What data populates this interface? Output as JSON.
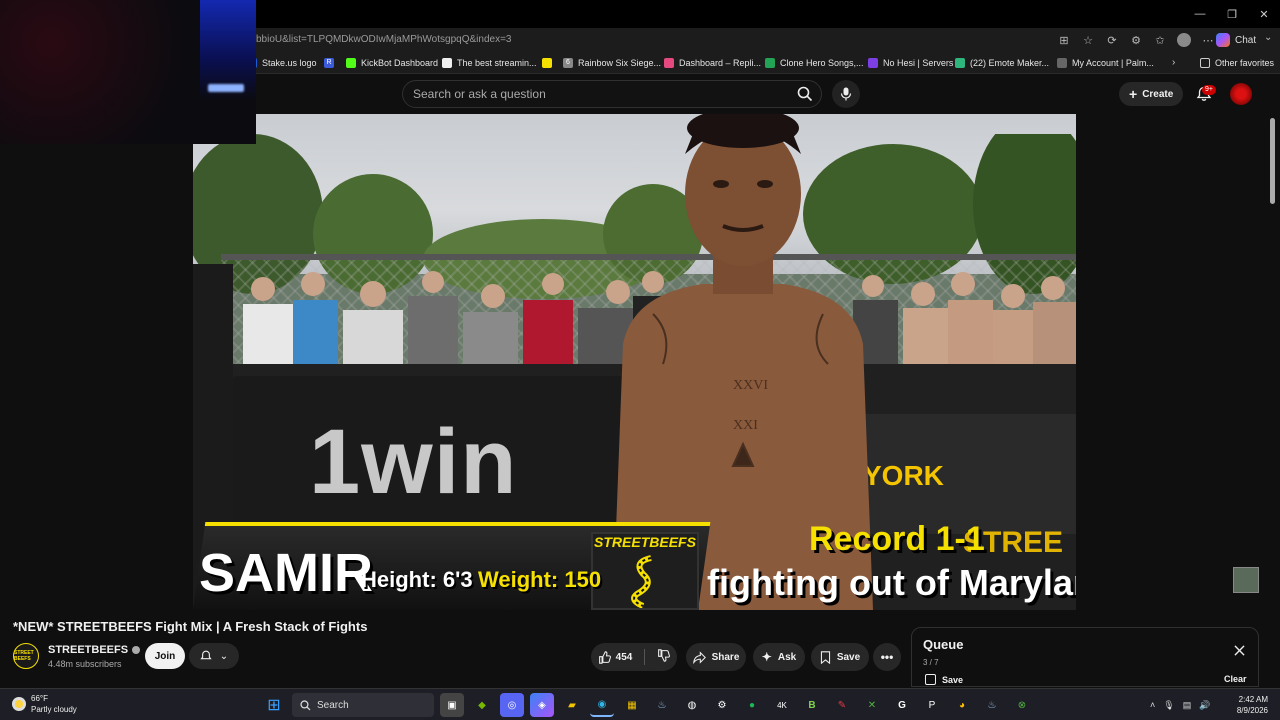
{
  "browser": {
    "url": "bbioU&list=TLPQMDkwODIwMjaMPhWotsgpqQ&index=3",
    "chat_label": "Chat",
    "bookmarks": [
      {
        "label": "Stake.us logo",
        "color": "#1e5bd8"
      },
      {
        "label": "",
        "color": "#3b5bdb",
        "glyph": "R"
      },
      {
        "label": "KickBot Dashboard",
        "color": "#53fc18"
      },
      {
        "label": "The best streamin...",
        "color": "#eeeeee"
      },
      {
        "label": "",
        "color": "#f5e000"
      },
      {
        "label": "Rainbow Six Siege...",
        "color": "#888888",
        "glyph": "6"
      },
      {
        "label": "Dashboard – Repli...",
        "color": "#e64980"
      },
      {
        "label": "Clone Hero Songs,...",
        "color": "#22a355"
      },
      {
        "label": "No Hesi | Servers",
        "color": "#7b3fe4"
      },
      {
        "label": "(22) Emote Maker...",
        "color": "#2fb67c"
      },
      {
        "label": "My Account | Palm...",
        "color": "#666666"
      }
    ],
    "other_favorites": "Other favorites"
  },
  "youtube": {
    "search_placeholder": "Search or ask a question",
    "create_label": "Create",
    "notification_count": "9+"
  },
  "video": {
    "brand": "1win",
    "board_text": "YORK",
    "board_text_2": "STREE",
    "logo_text": "STREETBEEFS",
    "fighter_name": "SAMIR",
    "height": "Height: 6'3",
    "weight": "Weight: 150",
    "record": "Record 1-1",
    "origin": "fighting out of Maryland"
  },
  "watch": {
    "title": "*NEW* STREETBEEFS Fight Mix | A Fresh Stack of Fights",
    "channel_name": "STREETBEEFS",
    "subscribers": "4.48m subscribers",
    "channel_avatar_text": "STREET BEEFS",
    "join_label": "Join",
    "like_count": "454",
    "share_label": "Share",
    "ask_label": "Ask",
    "save_label": "Save"
  },
  "queue": {
    "title": "Queue",
    "count": "3 / 7",
    "save_label": "Save",
    "clear_label": "Clear"
  },
  "taskbar": {
    "temperature": "66°F",
    "condition": "Partly cloudy",
    "search_label": "Search",
    "time": "2:42 AM",
    "date": "8/9/2026"
  },
  "colors": {
    "accent_yellow": "#f5e000",
    "yt_red": "#cc0000",
    "background": "#0f0f0f"
  }
}
